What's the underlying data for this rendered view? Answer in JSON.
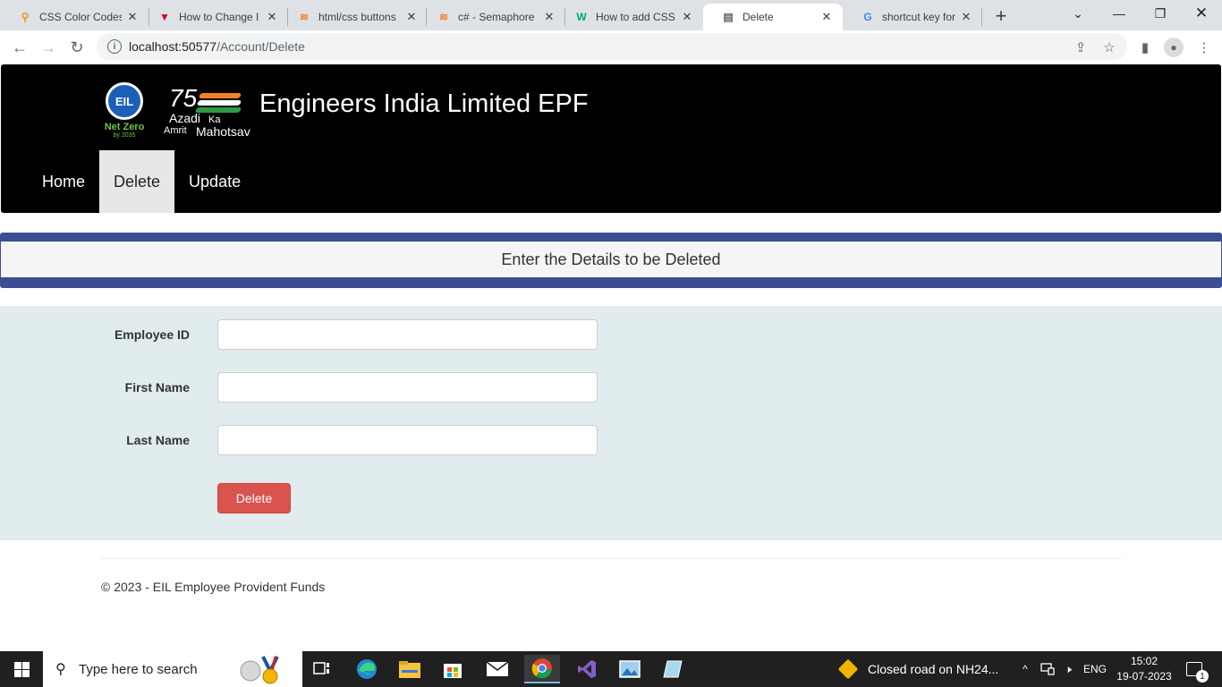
{
  "browser": {
    "tabs": [
      {
        "title": "CSS Color Codes",
        "icon": "orange-search-icon",
        "active": false
      },
      {
        "title": "How to Change I",
        "icon": "red-v-icon",
        "active": false
      },
      {
        "title": "html/css buttons",
        "icon": "stackoverflow-icon",
        "active": false
      },
      {
        "title": "c# - Semaphore",
        "icon": "stackoverflow-icon",
        "active": false
      },
      {
        "title": "How to add CSS",
        "icon": "w3-icon",
        "active": false
      },
      {
        "title": "Delete",
        "icon": "page-icon",
        "active": true
      },
      {
        "title": "shortcut key for s",
        "icon": "google-icon",
        "active": false
      }
    ],
    "url_host": "localhost:50577",
    "url_path": "/Account/Delete"
  },
  "header": {
    "logo_eil_text": "EIL",
    "logo_netzero": "Net Zero",
    "logo_netzero_sub": "by 2035",
    "logo_azadi_75": "75",
    "logo_azadi_word1": "Azadi",
    "logo_azadi_word2": "Ka",
    "logo_azadi_word3": "Amrit",
    "logo_azadi_word4": "Mahotsav",
    "title": "Engineers India Limited EPF",
    "nav": [
      {
        "label": "Home"
      },
      {
        "label": "Delete"
      },
      {
        "label": "Update"
      }
    ]
  },
  "banner": {
    "text": "Enter the Details to be Deleted"
  },
  "form": {
    "fields": [
      {
        "label": "Employee ID",
        "value": ""
      },
      {
        "label": "First Name",
        "value": ""
      },
      {
        "label": "Last Name",
        "value": ""
      }
    ],
    "submit_label": "Delete"
  },
  "footer": {
    "text": "© 2023 - EIL Employee Provident Funds"
  },
  "taskbar": {
    "search_placeholder": "Type here to search",
    "news_text": "Closed road on NH24...",
    "lang": "ENG",
    "time": "15:02",
    "date": "19-07-2023",
    "notification_count": "1"
  },
  "colors": {
    "header_bg": "#000000",
    "banner_band": "#3c4e92",
    "form_bg": "#e1ecee",
    "delete_button": "#d9534f"
  }
}
